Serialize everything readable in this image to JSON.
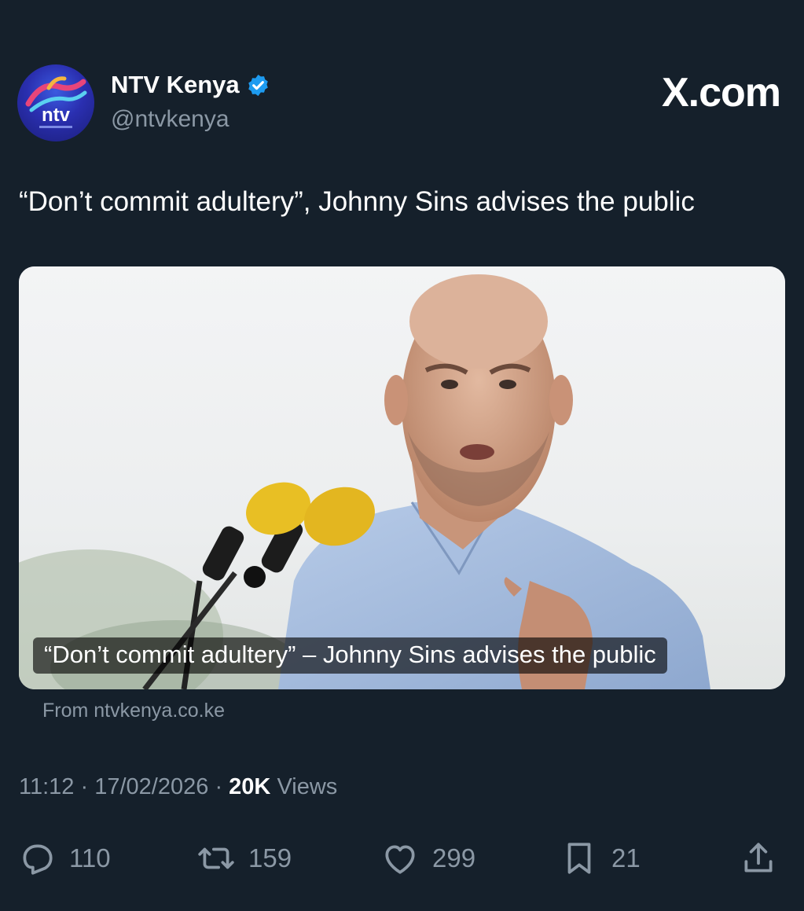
{
  "author": {
    "name": "NTV Kenya",
    "handle": "@ntvkenya",
    "verified": true,
    "avatar_text": "ntv"
  },
  "site_label": "X.com",
  "tweet": {
    "text": "“Don’t commit adultery”, Johnny Sins advises the public"
  },
  "media": {
    "caption": "“Don’t commit adultery” – Johnny Sins advises the public",
    "source": "From ntvkenya.co.ke"
  },
  "meta": {
    "time": "11:12",
    "date": "17/02/2026",
    "separator": "·",
    "views_count": "20K",
    "views_label": "Views"
  },
  "actions": {
    "replies": "110",
    "reposts": "159",
    "likes": "299",
    "bookmarks": "21"
  },
  "colors": {
    "background": "#15202b",
    "secondary_text": "#8b98a5",
    "verified_blue": "#1d9bf0"
  },
  "icons": [
    "verified-badge-icon",
    "reply-icon",
    "repost-icon",
    "like-icon",
    "bookmark-icon",
    "share-icon"
  ]
}
